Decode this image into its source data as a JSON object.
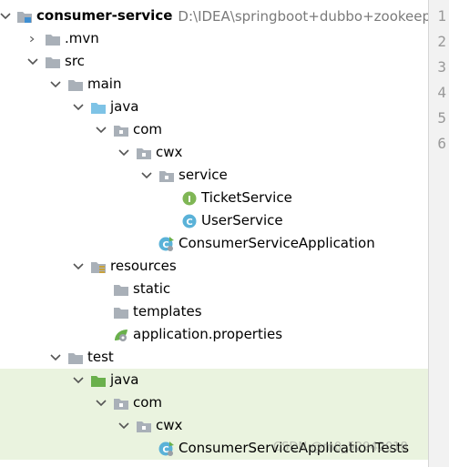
{
  "project_tree": {
    "rows": [
      {
        "label": "consumer-service",
        "path": "D:\\IDEA\\springboot+dubbo+zookeeper",
        "bold": true,
        "icon": "module-folder-icon",
        "arrow": "down",
        "level": 0
      },
      {
        "label": ".mvn",
        "icon": "folder-icon",
        "arrow": "right",
        "level": 1
      },
      {
        "label": "src",
        "icon": "folder-icon",
        "arrow": "down",
        "level": 1
      },
      {
        "label": "main",
        "icon": "folder-icon",
        "arrow": "down",
        "level": 2
      },
      {
        "label": "java",
        "icon": "source-folder-icon",
        "arrow": "down",
        "level": 3
      },
      {
        "label": "com",
        "icon": "package-icon",
        "arrow": "down",
        "level": 4
      },
      {
        "label": "cwx",
        "icon": "package-icon",
        "arrow": "down",
        "level": 5
      },
      {
        "label": "service",
        "icon": "package-icon",
        "arrow": "down",
        "level": 6
      },
      {
        "label": "TicketService",
        "icon": "interface-icon",
        "arrow": "none",
        "level": 7
      },
      {
        "label": "UserService",
        "icon": "class-icon",
        "arrow": "none",
        "level": 7
      },
      {
        "label": "ConsumerServiceApplication",
        "icon": "spring-boot-class-icon",
        "arrow": "none",
        "level": 6
      },
      {
        "label": "resources",
        "icon": "resources-folder-icon",
        "arrow": "down",
        "level": 3
      },
      {
        "label": "static",
        "icon": "folder-icon",
        "arrow": "none",
        "level": 4
      },
      {
        "label": "templates",
        "icon": "folder-icon",
        "arrow": "none",
        "level": 4
      },
      {
        "label": "application.properties",
        "icon": "spring-properties-icon",
        "arrow": "none",
        "level": 4
      },
      {
        "label": "test",
        "icon": "folder-icon",
        "arrow": "down",
        "level": 2
      },
      {
        "label": "java",
        "icon": "test-folder-icon",
        "arrow": "down",
        "level": 3,
        "highlight": true
      },
      {
        "label": "com",
        "icon": "package-icon",
        "arrow": "down",
        "level": 4,
        "highlight": true
      },
      {
        "label": "cwx",
        "icon": "package-icon",
        "arrow": "down",
        "level": 5,
        "highlight": true
      },
      {
        "label": "ConsumerServiceApplicationTests",
        "icon": "spring-boot-class-icon",
        "arrow": "none",
        "level": 6,
        "highlight": true
      }
    ]
  },
  "editor_gutter": {
    "line_numbers": [
      "1",
      "2",
      "3",
      "4",
      "5",
      "6"
    ]
  },
  "watermark": {
    "text": "CSDN @m0_52942018"
  },
  "colors": {
    "folder": "#a9b0b8",
    "source_folder": "#7ec3e6",
    "test_folder": "#6ab04c",
    "interface_circle": "#7fb655",
    "class_circle": "#5ab2d8",
    "test_highlight": "#eaf3df",
    "path_text": "#7a7a7a"
  }
}
